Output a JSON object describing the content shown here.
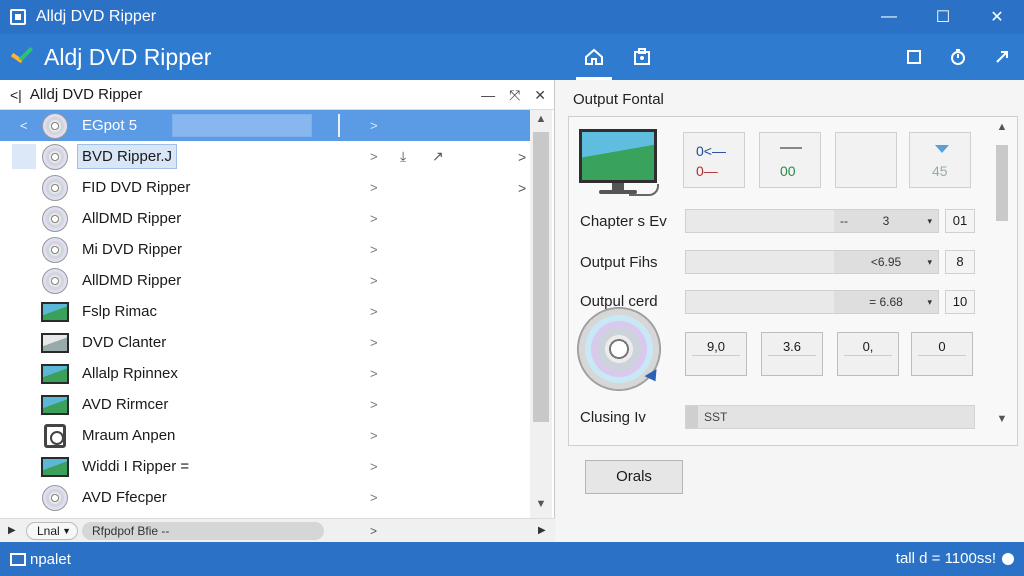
{
  "window": {
    "title": "Alldj DVD Ripper",
    "minimize": "—",
    "maximize": "☐",
    "close": "✕"
  },
  "app": {
    "title": "Aldj DVD Ripper",
    "tabs": [
      "home-icon",
      "media-icon"
    ],
    "right_buttons": [
      "window-icon",
      "timer-icon",
      "expand-icon"
    ]
  },
  "left_panel": {
    "header": "Alldj DVD Ripper",
    "back": "<|",
    "minimize": "—",
    "pin": "⤧",
    "close": "✕",
    "items": [
      {
        "label": "EGpot 5",
        "icon": "disc-icon",
        "selected": true
      },
      {
        "label": "BVD Ripper.J",
        "icon": "disc-icon",
        "highlight": true
      },
      {
        "label": "FID DVD Ripper",
        "icon": "disc-icon"
      },
      {
        "label": "AllDMD Ripper",
        "icon": "disc-icon"
      },
      {
        "label": "Mi DVD Ripper",
        "icon": "disc-icon"
      },
      {
        "label": "AllDMD Ripper",
        "icon": "disc-icon"
      },
      {
        "label": "Fslp Rimac",
        "icon": "monitor-icon"
      },
      {
        "label": "DVD Clanter",
        "icon": "monitor-icon"
      },
      {
        "label": "Allalp Rpinnex",
        "icon": "monitor-icon"
      },
      {
        "label": "AVD Rirmcer",
        "icon": "monitor-icon"
      },
      {
        "label": "Mraum Anpen",
        "icon": "reel-icon"
      },
      {
        "label": "Widdi I Ripper =",
        "icon": "monitor-icon"
      },
      {
        "label": "AVD Ffecper",
        "icon": "disc-icon"
      }
    ],
    "chevron": ">",
    "bottom": {
      "zoom": "Lnal",
      "chip": "Rfpdpof Bfie --"
    }
  },
  "right_panel": {
    "group_title": "Output Fontal",
    "tiles": [
      {
        "a": "0<—",
        "b": "0—"
      },
      {
        "c": "00"
      },
      {},
      {
        "d": "45"
      }
    ],
    "rows": [
      {
        "label": "Chapter s Ev",
        "value": "3",
        "small": "01",
        "left_mark": "--",
        "dropdown": "▾"
      },
      {
        "label": "Output Fihs",
        "value": "<6.95",
        "small": "8",
        "dropdown": "▾"
      },
      {
        "label": "Outpul cerd",
        "value": "= 6.68",
        "small": "10",
        "dropdown": "▾"
      }
    ],
    "small_boxes": [
      "9,0",
      "3.6",
      "0,",
      "0"
    ],
    "closing": {
      "label": "Clusing Iv",
      "value": "SST"
    },
    "button": "Orals"
  },
  "status": {
    "left": "npalet",
    "right": "tall d = 1100ss!"
  }
}
